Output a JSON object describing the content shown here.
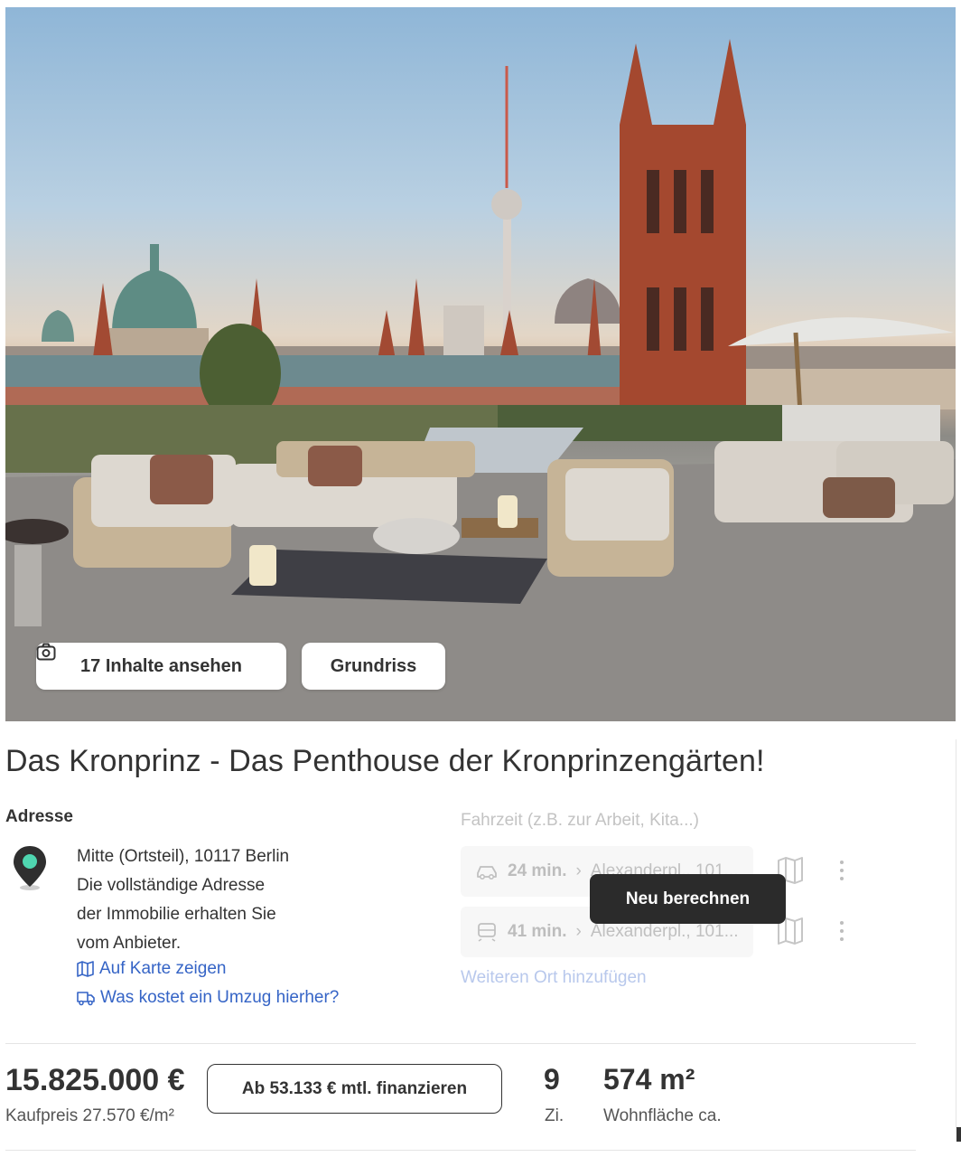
{
  "gallery": {
    "image_description_icon": "rooftop-terrace-photo",
    "view_contents_label": "17 Inhalte ansehen",
    "floorplan_label": "Grundriss"
  },
  "listing": {
    "title": "Das Kronprinz - Das Penthouse der Kronprinzengärten!"
  },
  "address": {
    "heading": "Adresse",
    "lines": [
      "Mitte (Ortsteil), 10117 Berlin",
      "Die vollständige Adresse",
      "der Immobilie erhalten Sie",
      "vom Anbieter."
    ],
    "show_map": "Auf Karte zeigen",
    "moving_cost": "Was kostet ein Umzug hierher?"
  },
  "travel": {
    "label": "Fahrzeit (z.B. zur Arbeit, Kita...)",
    "routes": [
      {
        "mode_icon": "car-icon",
        "minutes": "24 min.",
        "destination": "Alexanderpl., 101..."
      },
      {
        "mode_icon": "train-icon",
        "minutes": "41 min.",
        "destination": "Alexanderpl., 101..."
      }
    ],
    "recalc_tooltip": "Neu berechnen",
    "add_place": "Weiteren Ort hinzufügen"
  },
  "facts": {
    "price": "15.825.000 €",
    "price_sub": "Kaufpreis 27.570 €/m²",
    "finance_button": "Ab 53.133 € mtl. finanzieren",
    "rooms_value": "9",
    "rooms_label": "Zi.",
    "area_value": "574 m²",
    "area_label": "Wohnfläche ca."
  },
  "colors": {
    "link": "#3564c6",
    "text": "#333333",
    "pin_accent": "#4fd6b0",
    "tooltip_bg": "#2b2b2b"
  }
}
